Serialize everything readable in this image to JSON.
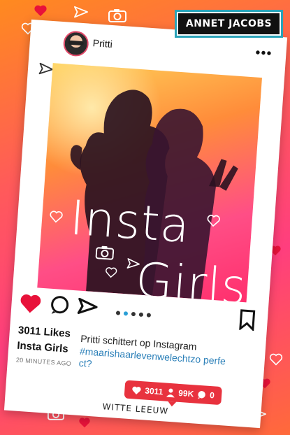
{
  "author": "ANNET JACOBS",
  "post": {
    "username": "Pritti",
    "title_line1": "Insta",
    "title_line2": "Girls",
    "likes": "3011 Likes",
    "caption_name": "Insta Girls",
    "timestamp": "20 MINUTES AGO",
    "caption_text": "Pritti schittert op Instagram",
    "caption_hashtag": "#maarishaarlevenwelechtzo perfect?"
  },
  "notification": {
    "likes": "3011",
    "followers": "99K",
    "comments": "0"
  },
  "publisher": "WITTE LEEUW",
  "colors": {
    "background_top": "#ff8a1f",
    "background_mid": "#ff3e7e",
    "heart_red": "#e8123a",
    "hashtag_blue": "#2a7fb8",
    "badge_border": "#2aa3b8"
  },
  "icons": [
    "heart-icon",
    "send-icon",
    "camera-icon",
    "comment-icon",
    "bookmark-icon",
    "more-icon",
    "person-icon"
  ]
}
